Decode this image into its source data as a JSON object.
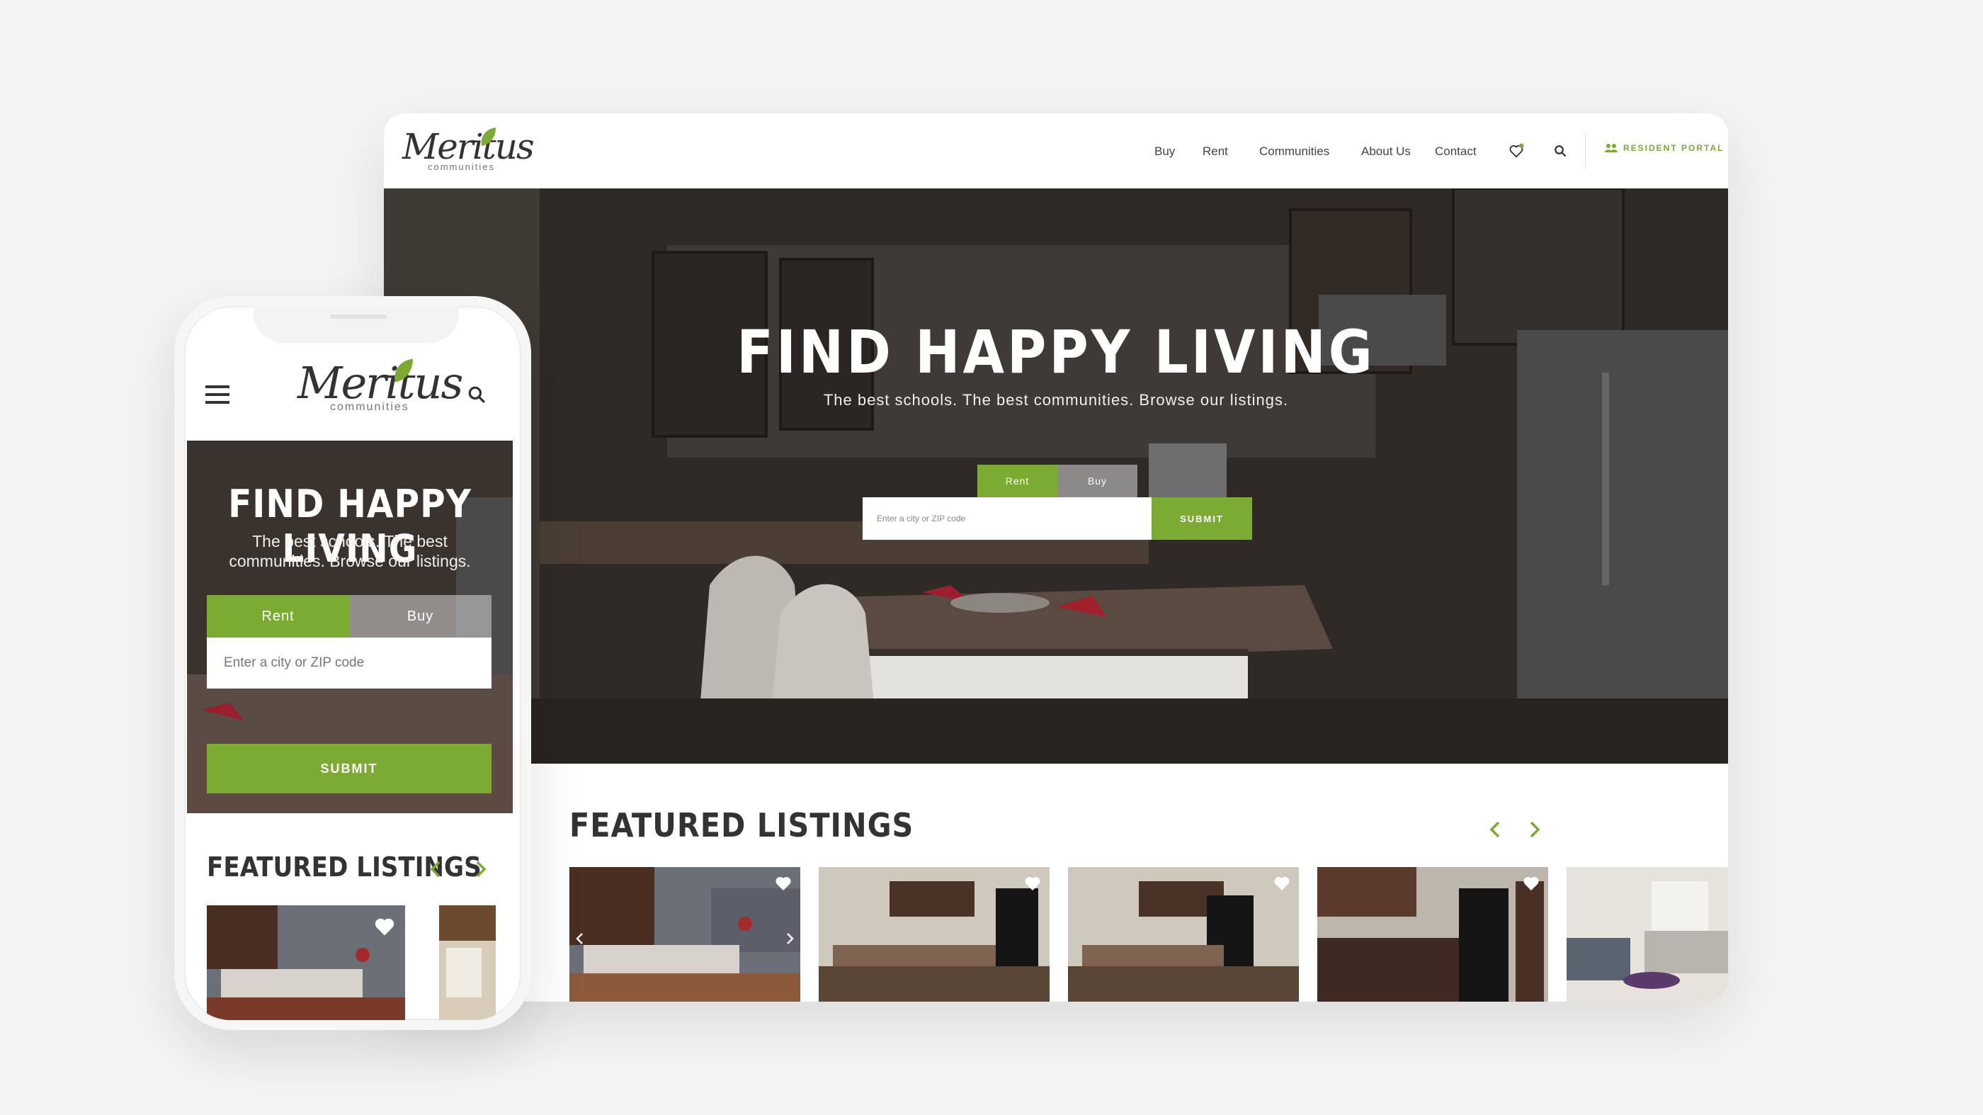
{
  "desktop": {
    "logo": {
      "script": "Meritus",
      "sub": "communities"
    },
    "nav": {
      "items": [
        "Buy",
        "Rent",
        "Communities",
        "About Us",
        "Contact"
      ],
      "resident_portal": "RESIDENT PORTAL"
    },
    "hero": {
      "title": "FIND HAPPY LIVING",
      "subtitle": "The best schools. The best communities. Browse our listings.",
      "tab_rent": "Rent",
      "tab_buy": "Buy",
      "search_placeholder": "Enter a city or ZIP code",
      "submit": "SUBMIT"
    },
    "featured": {
      "title": "FEATURED LISTINGS",
      "cards": [
        {
          "scene": "kitchen-gray"
        },
        {
          "scene": "kitchen-dark"
        },
        {
          "scene": "kitchen-dark"
        },
        {
          "scene": "kitchen-black"
        },
        {
          "scene": "living-room"
        }
      ]
    }
  },
  "mobile": {
    "logo": {
      "script": "Meritus",
      "sub": "communities"
    },
    "hero": {
      "title": "FIND HAPPY LIVING",
      "subtitle": "The best schools. The best communities. Browse our listings.",
      "tab_rent": "Rent",
      "tab_buy": "Buy",
      "search_placeholder": "Enter a city or ZIP code",
      "submit": "SUBMIT"
    },
    "featured": {
      "title": "FEATURED LISTINGS"
    }
  },
  "colors": {
    "accent": "#7cab34",
    "text": "#333333"
  },
  "icons": [
    "heart-icon",
    "search-icon",
    "menu-icon",
    "chevron-left-icon",
    "chevron-right-icon",
    "leaf-icon"
  ]
}
